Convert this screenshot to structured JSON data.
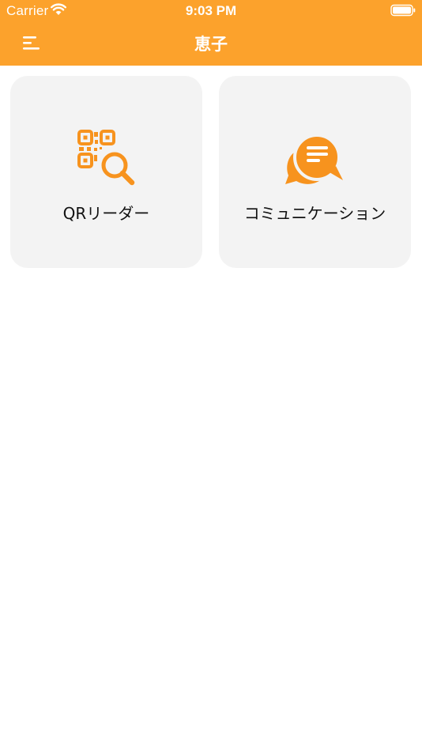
{
  "status_bar": {
    "carrier": "Carrier",
    "time": "9:03 PM",
    "wifi_icon": "wifi-icon",
    "battery_icon": "battery-full-icon"
  },
  "nav": {
    "menu_icon": "menu-icon",
    "title": "恵子"
  },
  "tiles": [
    {
      "label": "QRリーダー",
      "icon": "qr-search-icon"
    },
    {
      "label": "コミュニケーション",
      "icon": "chat-bubbles-icon"
    }
  ],
  "colors": {
    "accent": "#FCA22C",
    "icon_orange": "#F7931E",
    "tile_bg": "#F3F3F3",
    "text": "#111111"
  }
}
